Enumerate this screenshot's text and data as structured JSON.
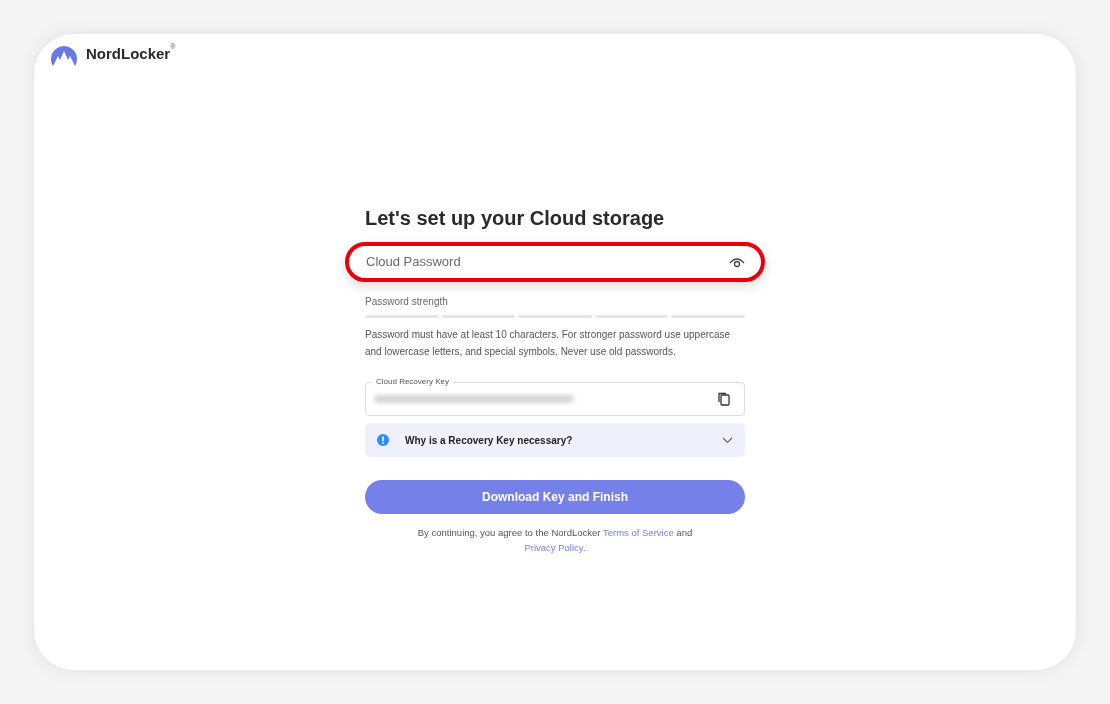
{
  "brand": {
    "name": "NordLocker",
    "mark": "®"
  },
  "title": "Let's set up your Cloud storage",
  "password": {
    "placeholder": "Cloud Password",
    "highlighted": true
  },
  "strength": {
    "label": "Password strength"
  },
  "hint": "Password must have at least 10 characters. For stronger password use uppercase and lowercase letters, and special symbols. Never use old passwords.",
  "recovery_key": {
    "label": "Cloud Recovery Key",
    "blurred": true
  },
  "faq": {
    "label": "Why is a Recovery Key necessary?",
    "expanded": false
  },
  "submit": {
    "label": "Download Key and Finish"
  },
  "legal": {
    "before": "By continuing, you agree to the NordLocker",
    "link1": "Terms of Service",
    "middle": "and",
    "link2": "Privacy Policy",
    "after": "."
  }
}
